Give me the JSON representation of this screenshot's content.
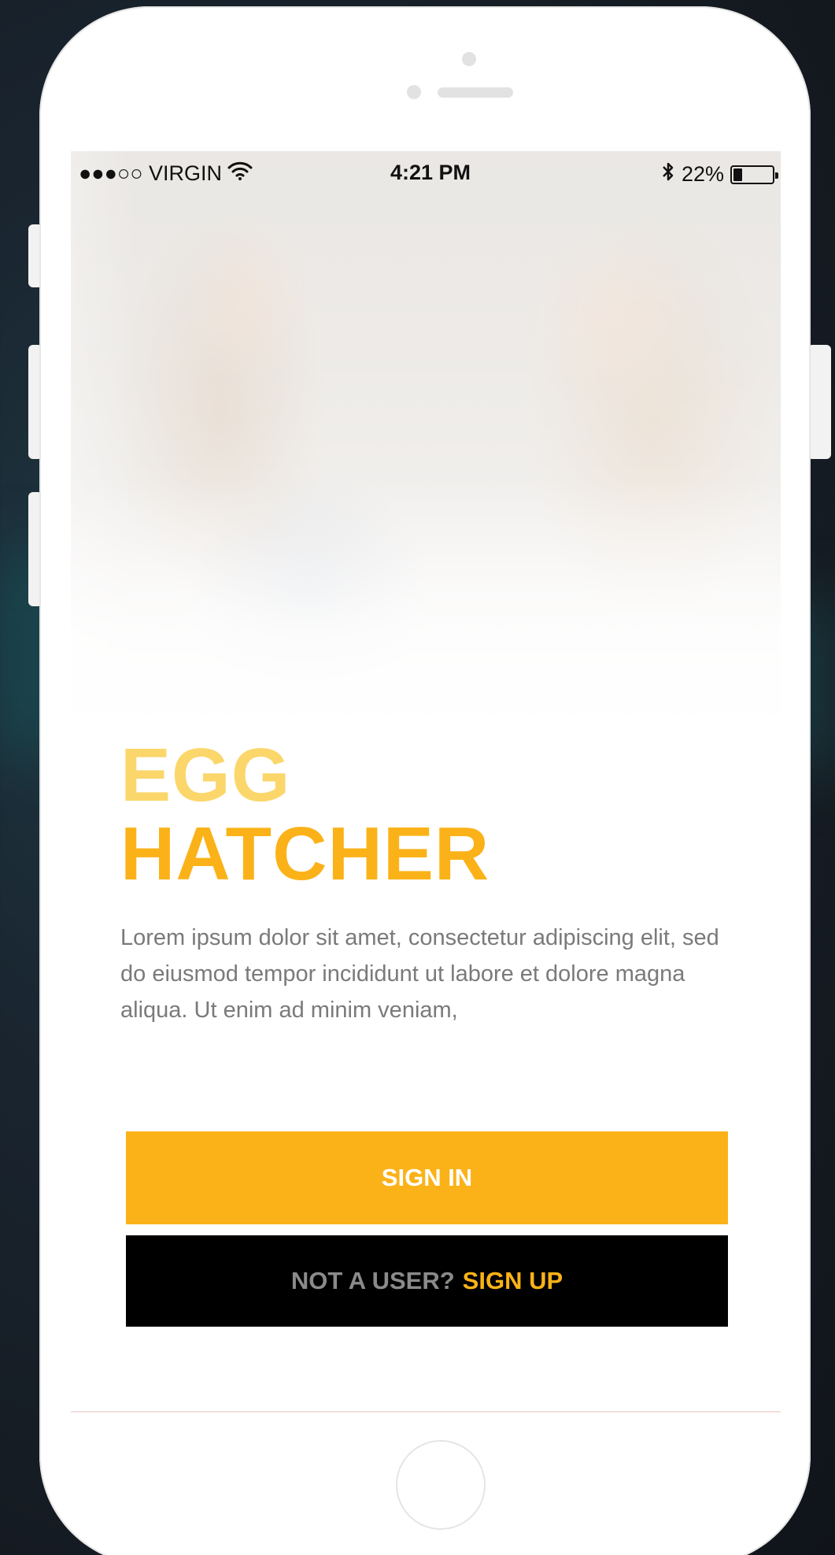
{
  "status_bar": {
    "carrier": "●●●○○ VIRGIN",
    "time": "4:21 PM",
    "battery_text": "22%",
    "battery_level": 0.22,
    "icons": [
      "wifi-icon",
      "bluetooth-icon",
      "battery-icon"
    ]
  },
  "app": {
    "title_line1": "EGG",
    "title_line2": "HATCHER",
    "description": "Lorem ipsum dolor sit amet, consectetur adipiscing elit, sed do eiusmod tempor incididunt ut labore et dolore magna aliqua. Ut enim ad minim veniam,"
  },
  "actions": {
    "sign_in_label": "SIGN IN",
    "sign_up_prompt": "NOT A USER?",
    "sign_up_label": "SIGN UP"
  },
  "colors": {
    "accent": "#fbb218",
    "accent_light": "#fbd66a",
    "text_muted": "#7a7a7a",
    "button_dark": "#000000"
  }
}
